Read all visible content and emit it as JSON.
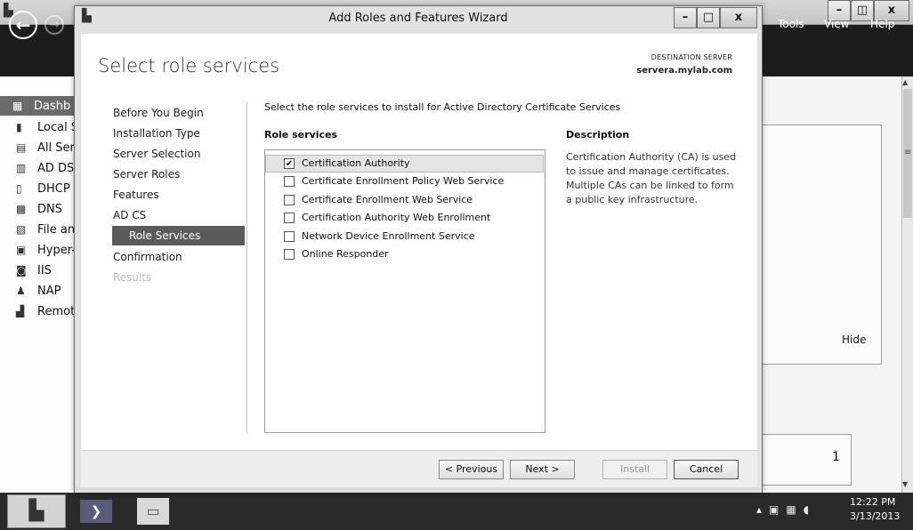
{
  "background_window": {
    "menu": {
      "tools": "Tools",
      "view": "View",
      "help": "Help"
    },
    "sidebar": [
      {
        "label": "Dashb",
        "icon": "dashboard-icon"
      },
      {
        "label": "Local S",
        "icon": "server-icon"
      },
      {
        "label": "All Ser",
        "icon": "servers-icon"
      },
      {
        "label": "AD DS",
        "icon": "directory-icon"
      },
      {
        "label": "DHCP",
        "icon": "dhcp-icon"
      },
      {
        "label": "DNS",
        "icon": "dns-icon"
      },
      {
        "label": "File an",
        "icon": "file-services-icon"
      },
      {
        "label": "Hyper-",
        "icon": "hyperv-icon"
      },
      {
        "label": "IIS",
        "icon": "iis-icon"
      },
      {
        "label": "NAP",
        "icon": "nap-icon"
      },
      {
        "label": "Remot",
        "icon": "remote-desktop-icon"
      }
    ],
    "hide_label": "Hide",
    "count": "1"
  },
  "wizard": {
    "title": "Add Roles and Features Wizard",
    "page_title": "Select role services",
    "destination_label": "DESTINATION SERVER",
    "destination_server": "servera.mylab.com",
    "steps": [
      {
        "label": "Before You Begin",
        "state": "normal"
      },
      {
        "label": "Installation Type",
        "state": "normal"
      },
      {
        "label": "Server Selection",
        "state": "normal"
      },
      {
        "label": "Server Roles",
        "state": "normal"
      },
      {
        "label": "Features",
        "state": "normal"
      },
      {
        "label": "AD CS",
        "state": "normal"
      },
      {
        "label": "Role Services",
        "state": "current"
      },
      {
        "label": "Confirmation",
        "state": "normal"
      },
      {
        "label": "Results",
        "state": "disabled"
      }
    ],
    "instructions": "Select the role services to install for Active Directory Certificate Services",
    "role_services_header": "Role services",
    "description_header": "Description",
    "description_text": "Certification Authority (CA) is used to issue and manage certificates. Multiple CAs can be linked to form a public key infrastructure.",
    "role_services": [
      {
        "label": "Certification Authority",
        "checked": true,
        "selected": true
      },
      {
        "label": "Certificate Enrollment Policy Web Service",
        "checked": false,
        "selected": false
      },
      {
        "label": "Certificate Enrollment Web Service",
        "checked": false,
        "selected": false
      },
      {
        "label": "Certification Authority Web Enrollment",
        "checked": false,
        "selected": false
      },
      {
        "label": "Network Device Enrollment Service",
        "checked": false,
        "selected": false
      },
      {
        "label": "Online Responder",
        "checked": false,
        "selected": false
      }
    ],
    "buttons": {
      "previous": "< Previous",
      "next": "Next >",
      "install": "Install",
      "cancel": "Cancel"
    },
    "window_controls": {
      "minimize": "–",
      "maximize": "□",
      "close": "x"
    }
  },
  "taskbar": {
    "time": "12:22 PM",
    "date": "3/13/2013",
    "tray_icons": [
      "up-arrow-icon",
      "network-icon",
      "action-center-icon",
      "volume-icon"
    ]
  },
  "colors": {
    "header_bg": "#1c1c1c",
    "selected_step_bg": "#5b5b5b",
    "taskbar_bg": "#2a2a2a"
  }
}
